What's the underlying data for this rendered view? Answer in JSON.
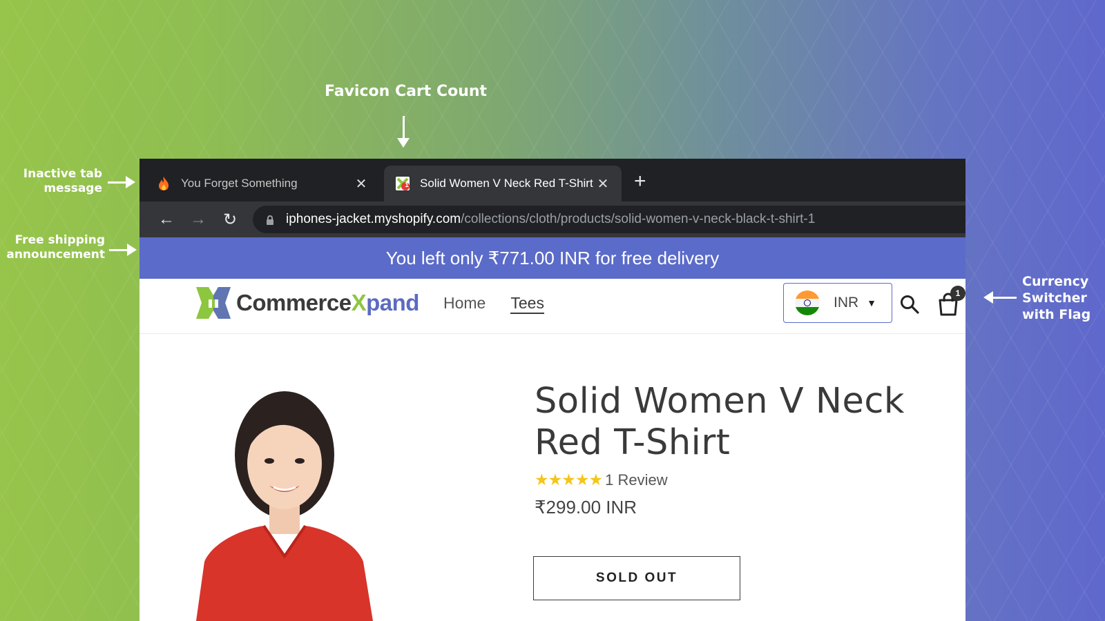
{
  "annotations": {
    "favicon_cart_count": "Favicon Cart Count",
    "inactive_tab_line1": "Inactive tab",
    "inactive_tab_line2": "message",
    "free_shipping_line1": "Free shipping",
    "free_shipping_line2": "announcement",
    "currency_line1": "Currency",
    "currency_line2": "Switcher",
    "currency_line3": "with Flag"
  },
  "browser": {
    "tabs": [
      {
        "title": "You Forget Something",
        "favicon": "fire-icon",
        "active": false
      },
      {
        "title": "Solid Women V Neck Red T-Shirt",
        "favicon": "cart-count-favicon",
        "badge": "1",
        "active": true
      }
    ],
    "url_domain": "iphones-jacket.myshopify.com",
    "url_path": "/collections/cloth/products/solid-women-v-neck-black-t-shirt-1"
  },
  "store": {
    "announcement": "You left only ₹771.00 INR for free delivery",
    "logo_text_1": "Commerce",
    "logo_text_2": "X",
    "logo_text_3": "pand",
    "nav": [
      "Home",
      "Tees"
    ],
    "nav_active": "Tees",
    "currency_code": "INR",
    "cart_count": "1"
  },
  "product": {
    "title": "Solid Women V Neck Red T-Shirt",
    "stars": "★★★★★",
    "reviews": "1 Review",
    "price": "₹299.00 INR",
    "button": "SOLD OUT"
  },
  "colors": {
    "announcement_bg": "#5b6bc9",
    "brand_green": "#8dc63f",
    "brand_blue": "#5c6bc0",
    "shirt_red": "#d8342a"
  }
}
